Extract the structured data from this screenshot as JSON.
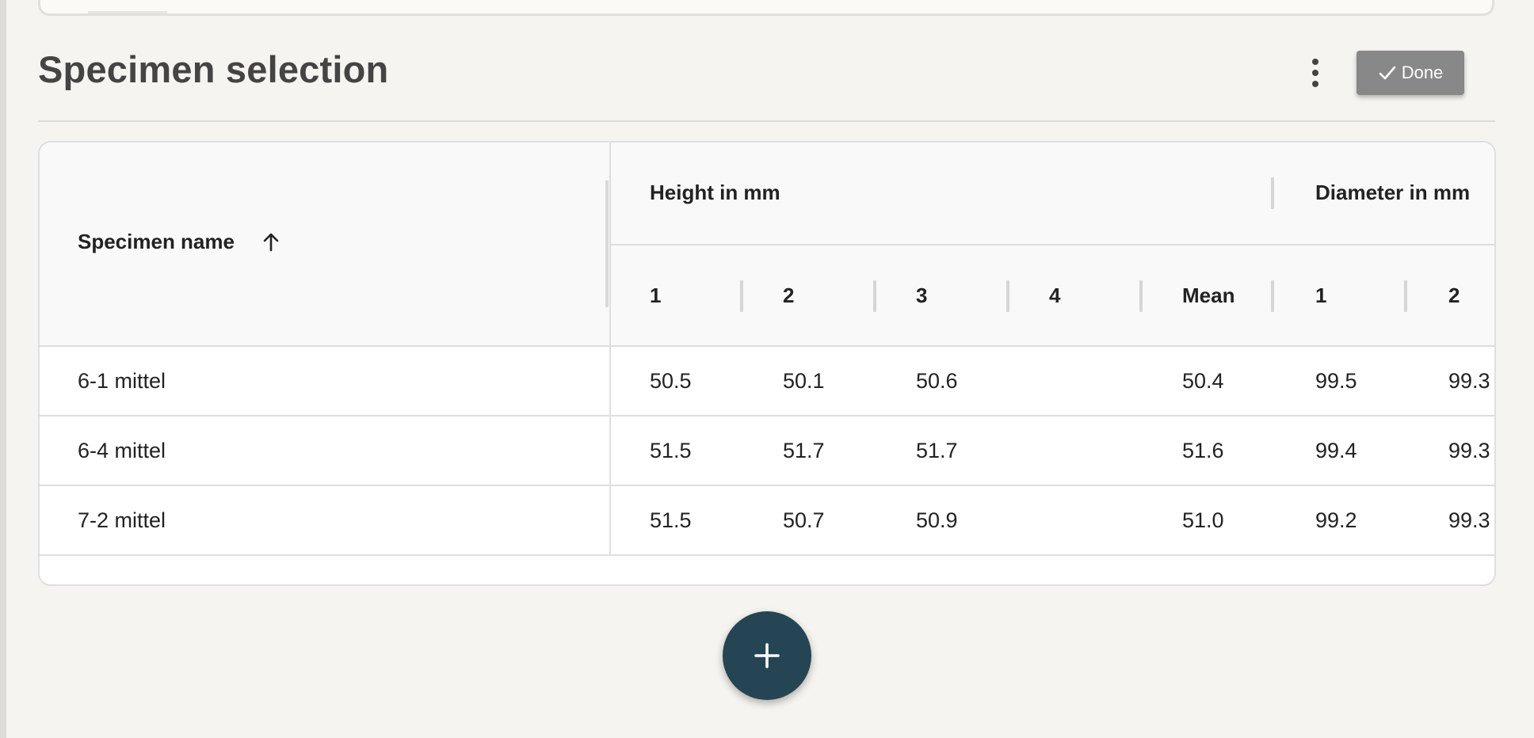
{
  "section": {
    "title": "Specimen selection",
    "done_label": "Done",
    "icons": {
      "menu": "more-vertical-icon",
      "done": "check-icon",
      "sort": "arrow-up-icon",
      "add": "plus-icon"
    }
  },
  "table": {
    "name_header": "Specimen name",
    "groups": {
      "height": "Height in mm",
      "diameter": "Diameter in mm"
    },
    "sub_headers": [
      "1",
      "2",
      "3",
      "4",
      "Mean",
      "1",
      "2"
    ],
    "rows": [
      {
        "name": "6-1 mittel",
        "h1": "50.5",
        "h2": "50.1",
        "h3": "50.6",
        "h4": "",
        "mean": "50.4",
        "d1": "99.5",
        "d2": "99.3"
      },
      {
        "name": "6-4 mittel",
        "h1": "51.5",
        "h2": "51.7",
        "h3": "51.7",
        "h4": "",
        "mean": "51.6",
        "d1": "99.4",
        "d2": "99.3"
      },
      {
        "name": "7-2 mittel",
        "h1": "51.5",
        "h2": "50.7",
        "h3": "50.9",
        "h4": "",
        "mean": "51.0",
        "d1": "99.2",
        "d2": "99.3"
      }
    ]
  },
  "colors": {
    "done_button": "#888888",
    "fab": "#264554",
    "background": "#f5f4f0"
  }
}
